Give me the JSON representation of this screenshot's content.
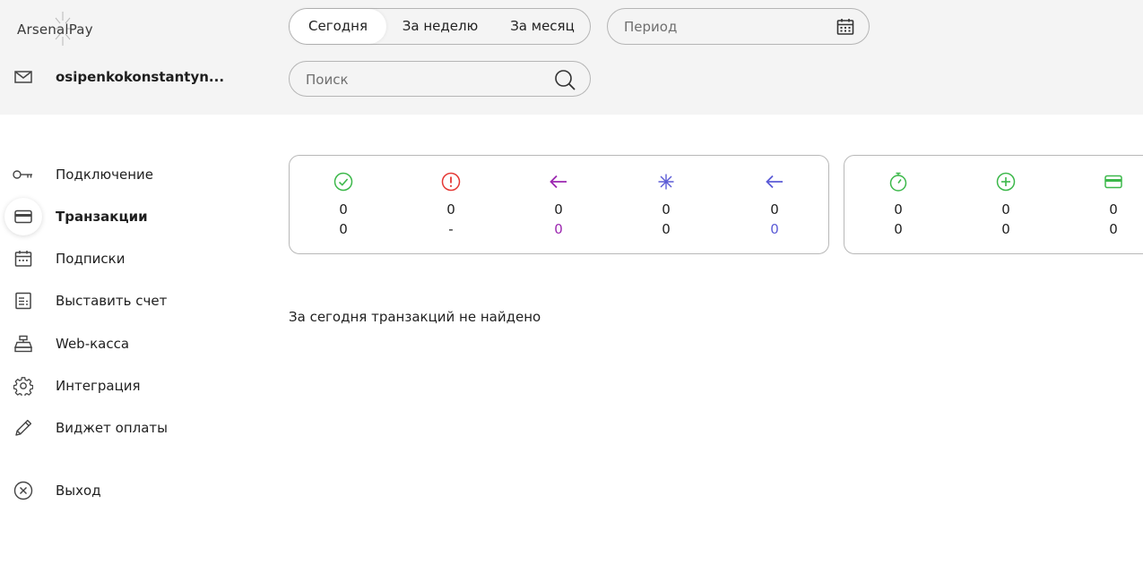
{
  "brand": {
    "name": "ArsenalPay"
  },
  "user": {
    "email": "osipenkokonstantyn..."
  },
  "periods": [
    {
      "label": "Сегодня",
      "active": true
    },
    {
      "label": "За неделю",
      "active": false
    },
    {
      "label": "За месяц",
      "active": false
    }
  ],
  "range": {
    "placeholder": "Период"
  },
  "search": {
    "placeholder": "Поиск"
  },
  "nav": [
    {
      "label": "Подключение",
      "icon": "key-icon"
    },
    {
      "label": "Транзакции",
      "icon": "card-icon",
      "active": true
    },
    {
      "label": "Подписки",
      "icon": "calendar-icon"
    },
    {
      "label": "Выставить счет",
      "icon": "invoice-icon"
    },
    {
      "label": "Web-касса",
      "icon": "cash-register-icon"
    },
    {
      "label": "Интеграция",
      "icon": "gear-icon"
    },
    {
      "label": "Виджет оплаты",
      "icon": "pencil-icon"
    },
    {
      "label": "Выход",
      "icon": "close-circle-icon"
    }
  ],
  "stats_group_1": [
    {
      "icon": "check-circle-icon",
      "color": "#3cb84a",
      "count": "0",
      "amount": "0",
      "amount_color": "#1f1f1f"
    },
    {
      "icon": "alert-circle-icon",
      "color": "#e53935",
      "count": "0",
      "amount": "-",
      "amount_color": "#1f1f1f"
    },
    {
      "icon": "arrow-left-icon",
      "color": "#9c27b0",
      "count": "0",
      "amount": "0",
      "amount_color": "#9c27b0"
    },
    {
      "icon": "snowflake-icon",
      "color": "#5b5bd6",
      "count": "0",
      "amount": "0",
      "amount_color": "#1f1f1f"
    },
    {
      "icon": "arrow-left-icon",
      "color": "#5b5bd6",
      "count": "0",
      "amount": "0",
      "amount_color": "#5b5bd6"
    }
  ],
  "stats_group_2": [
    {
      "icon": "stopwatch-icon",
      "color": "#3cb84a",
      "count": "0",
      "amount": "0"
    },
    {
      "icon": "plus-circle-icon",
      "color": "#3cb84a",
      "count": "0",
      "amount": "0"
    },
    {
      "icon": "card-icon",
      "color": "#3cb84a",
      "count": "0",
      "amount": "0"
    }
  ],
  "empty_message": "За сегодня транзакций не найдено"
}
